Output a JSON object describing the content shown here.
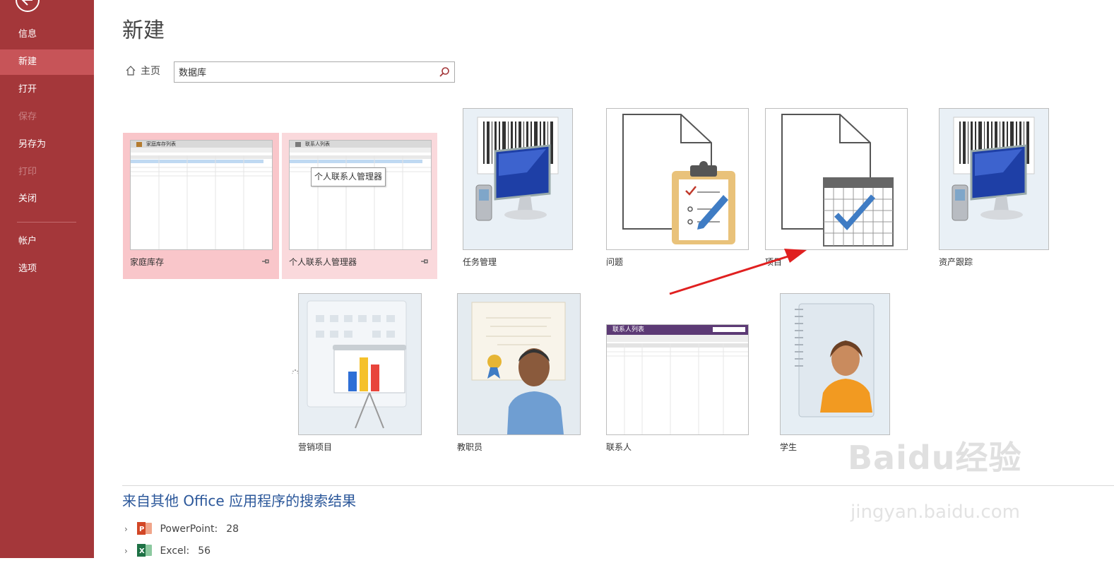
{
  "sidebar": {
    "items": [
      {
        "label": "信息",
        "state": "normal"
      },
      {
        "label": "新建",
        "state": "active"
      },
      {
        "label": "打开",
        "state": "normal"
      },
      {
        "label": "保存",
        "state": "disabled"
      },
      {
        "label": "另存为",
        "state": "normal"
      },
      {
        "label": "打印",
        "state": "disabled"
      },
      {
        "label": "关闭",
        "state": "normal"
      },
      {
        "label": "帐户",
        "state": "normal"
      },
      {
        "label": "选项",
        "state": "normal"
      }
    ]
  },
  "main": {
    "title": "新建",
    "home_label": "主页",
    "search_value": "数据库",
    "tooltip": "个人联系人管理器",
    "templates": [
      {
        "label": "家庭库存",
        "thumb_title": "家庭库存列表"
      },
      {
        "label": "个人联系人管理器",
        "thumb_title": "联系人列表"
      },
      {
        "label": "任务管理"
      },
      {
        "label": "问题"
      },
      {
        "label": "项目"
      },
      {
        "label": "资产跟踪"
      },
      {
        "label": "营销项目"
      },
      {
        "label": "教职员"
      },
      {
        "label": "联系人",
        "thumb_title": "联系人列表"
      },
      {
        "label": "学生"
      }
    ],
    "other_results_title": "来自其他 Office 应用程序的搜索结果",
    "other_results": [
      {
        "app": "PowerPoint:",
        "count": "28",
        "icon": "powerpoint-icon"
      },
      {
        "app": "Excel:",
        "count": "56",
        "icon": "excel-icon"
      }
    ]
  },
  "watermark": {
    "brand": "Baidu经验",
    "url": "jingyan.baidu.com"
  },
  "colors": {
    "sidebar": "#A4373A",
    "active": "#C75458",
    "accent_blue": "#2B579A",
    "selected_tile": "#F9C6CA"
  }
}
